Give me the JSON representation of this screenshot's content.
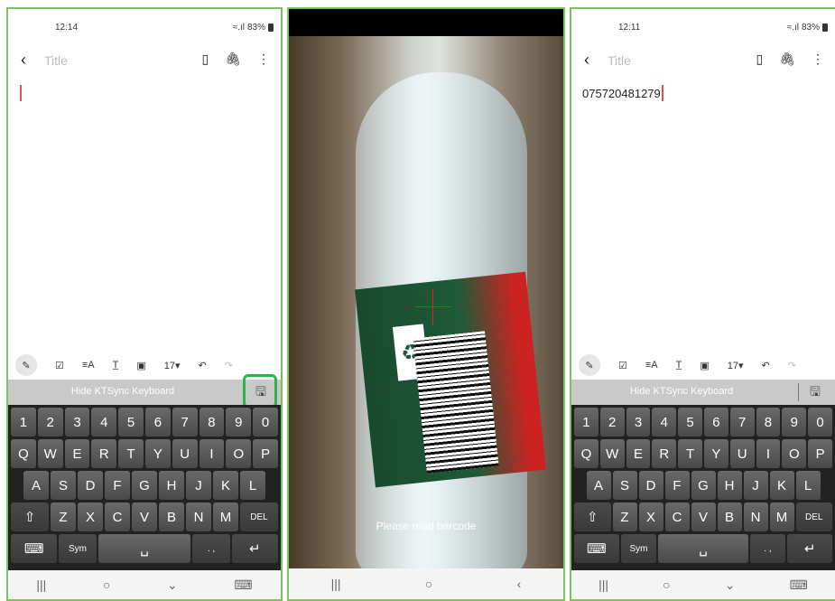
{
  "panels": [
    {
      "status": {
        "time": "12:14",
        "battery": "83%"
      },
      "appbar": {
        "title_placeholder": "Title"
      },
      "body_text": "",
      "fmt_font_size": "17▾",
      "ktsync_label": "Hide KTSync Keyboard"
    },
    {
      "hint": "Please read barcode"
    },
    {
      "status": {
        "time": "12:11",
        "battery": "83%"
      },
      "appbar": {
        "title_placeholder": "Title"
      },
      "body_text": "075720481279",
      "fmt_font_size": "17▾",
      "ktsync_label": "Hide KTSync Keyboard"
    }
  ],
  "keyboard": {
    "row1": [
      "1",
      "2",
      "3",
      "4",
      "5",
      "6",
      "7",
      "8",
      "9",
      "0"
    ],
    "row2": [
      "Q",
      "W",
      "E",
      "R",
      "T",
      "Y",
      "U",
      "I",
      "O",
      "P"
    ],
    "row3": [
      "A",
      "S",
      "D",
      "F",
      "G",
      "H",
      "J",
      "K",
      "L"
    ],
    "row4": [
      "Z",
      "X",
      "C",
      "V",
      "B",
      "N",
      "M"
    ],
    "sym": "Sym",
    "del": "DEL",
    "punct": ". ,"
  },
  "icons": {
    "back": "‹",
    "book": "▯",
    "attach": "⌕",
    "more": "⋮",
    "undo": "↶",
    "redo": "↷",
    "enter": "↵",
    "recents": "|||",
    "home": "○",
    "navback": "‹",
    "scan": "⌂"
  }
}
